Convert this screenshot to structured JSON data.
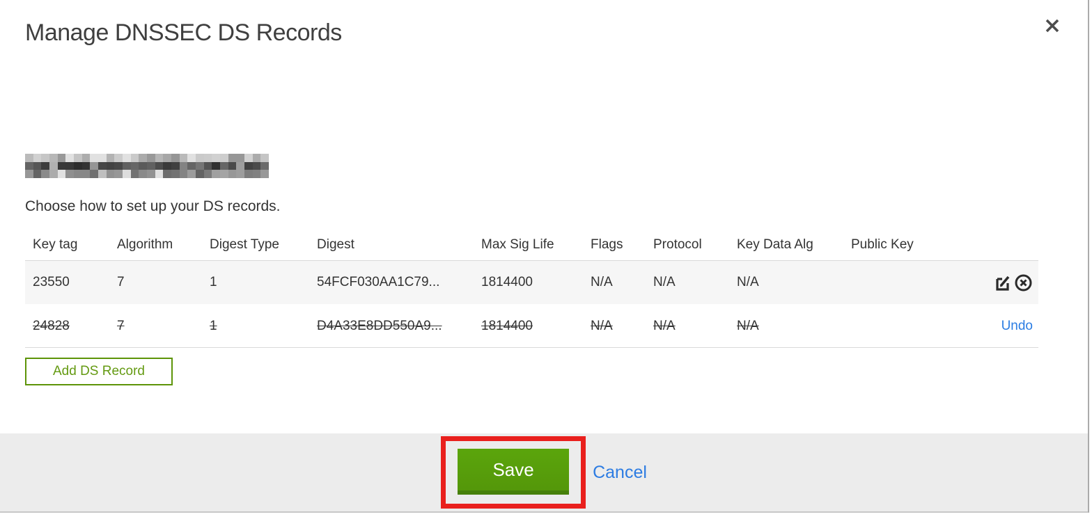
{
  "modal": {
    "title": "Manage DNSSEC DS Records",
    "instruction": "Choose how to set up your DS records.",
    "domain_redacted": true
  },
  "table": {
    "columns": [
      "Key tag",
      "Algorithm",
      "Digest Type",
      "Digest",
      "Max Sig Life",
      "Flags",
      "Protocol",
      "Key Data Alg",
      "Public Key"
    ],
    "rows": [
      {
        "key_tag": "23550",
        "algorithm": "7",
        "digest_type": "1",
        "digest": "54FCF030AA1C79...",
        "max_sig_life": "1814400",
        "flags": "N/A",
        "protocol": "N/A",
        "key_data_alg": "N/A",
        "public_key": "",
        "state": "active",
        "action_icons": [
          "edit-icon",
          "remove-icon"
        ]
      },
      {
        "key_tag": "24828",
        "algorithm": "7",
        "digest_type": "1",
        "digest": "D4A33E8DD550A9...",
        "max_sig_life": "1814400",
        "flags": "N/A",
        "protocol": "N/A",
        "key_data_alg": "N/A",
        "public_key": "",
        "state": "deleted",
        "undo_label": "Undo"
      }
    ],
    "add_button_label": "Add DS Record"
  },
  "footer": {
    "save_label": "Save",
    "cancel_label": "Cancel"
  },
  "colors": {
    "accent_green": "#54970a",
    "green_border": "#5d9408",
    "link_blue": "#2b7de3",
    "annotation_red": "#e9201d",
    "footer_bg": "#ececec",
    "row_alt_bg": "#f6f6f6"
  }
}
